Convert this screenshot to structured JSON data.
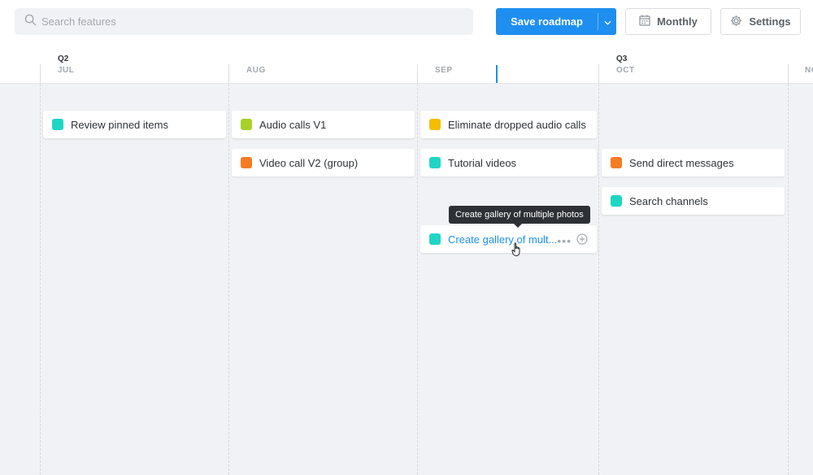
{
  "search": {
    "placeholder": "Search features",
    "icon": "search-icon"
  },
  "toolbar": {
    "save_label": "Save roadmap",
    "monthly_label": "Monthly",
    "settings_label": "Settings"
  },
  "timeline": {
    "quarters": [
      "Q2",
      "Q3"
    ],
    "months": [
      "JUL",
      "AUG",
      "SEP",
      "OCT",
      "NO"
    ]
  },
  "colors": {
    "accent": "#1e8ff0",
    "teal": "#1fd6c4",
    "lime": "#a7d129",
    "yellow": "#f5bd00",
    "orange": "#f57c24"
  },
  "features": [
    {
      "label": "Review pinned items",
      "color": "#1fd6c4"
    },
    {
      "label": "Audio calls V1",
      "color": "#a7d129"
    },
    {
      "label": "Eliminate dropped audio calls",
      "color": "#f5bd00"
    },
    {
      "label": "Video call V2 (group)",
      "color": "#f57c24"
    },
    {
      "label": "Tutorial videos",
      "color": "#1fd6c4"
    },
    {
      "label": "Send direct messages",
      "color": "#f57c24"
    },
    {
      "label": "Search channels",
      "color": "#1fd6c4"
    },
    {
      "label": "Create gallery of mult...",
      "color": "#1fd6c4"
    }
  ],
  "tooltip": {
    "text": "Create gallery of multiple photos"
  }
}
